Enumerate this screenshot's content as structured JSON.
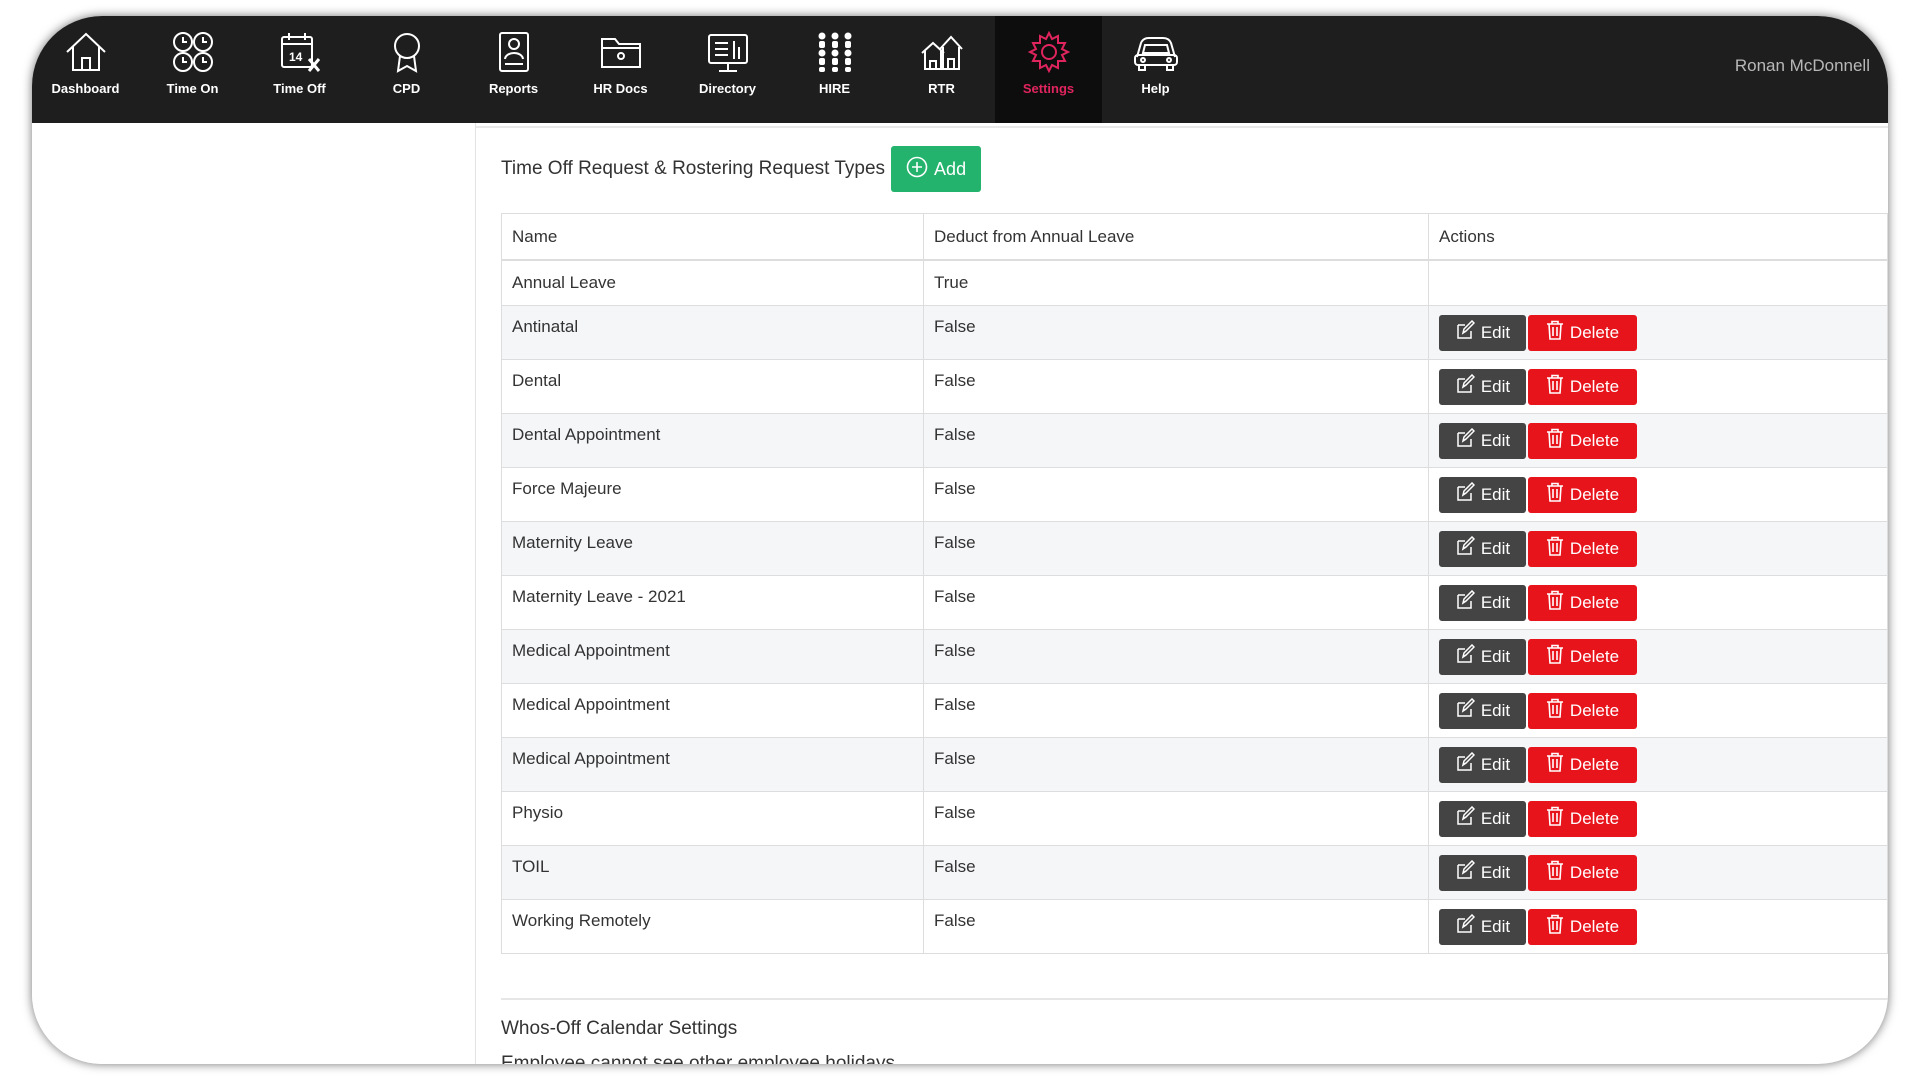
{
  "nav": {
    "items": [
      {
        "label": "Dashboard",
        "icon": "house-icon"
      },
      {
        "label": "Time On",
        "icon": "clocks-icon"
      },
      {
        "label": "Time Off",
        "icon": "calendar-x-icon"
      },
      {
        "label": "CPD",
        "icon": "award-ribbon-icon"
      },
      {
        "label": "Reports",
        "icon": "report-document-icon"
      },
      {
        "label": "HR Docs",
        "icon": "folder-icon"
      },
      {
        "label": "Directory",
        "icon": "directory-board-icon"
      },
      {
        "label": "HIRE",
        "icon": "people-grid-icon"
      },
      {
        "label": "RTR",
        "icon": "houses-icon"
      },
      {
        "label": "Settings",
        "icon": "gear-icon",
        "active": true
      },
      {
        "label": "Help",
        "icon": "car-icon"
      }
    ],
    "active_color": "#e0245e"
  },
  "user": {
    "name": "Ronan McDonnell"
  },
  "section": {
    "title": "Time Off Request & Rostering Request Types",
    "add_label": "Add"
  },
  "table": {
    "headers": [
      "Name",
      "Deduct from Annual Leave",
      "Actions"
    ],
    "edit_label": "Edit",
    "delete_label": "Delete",
    "rows": [
      {
        "name": "Annual Leave",
        "deduct": "True",
        "actions": false
      },
      {
        "name": "Antinatal",
        "deduct": "False",
        "actions": true
      },
      {
        "name": "Dental",
        "deduct": "False",
        "actions": true
      },
      {
        "name": "Dental Appointment",
        "deduct": "False",
        "actions": true
      },
      {
        "name": "Force Majeure",
        "deduct": "False",
        "actions": true
      },
      {
        "name": "Maternity Leave",
        "deduct": "False",
        "actions": true
      },
      {
        "name": "Maternity Leave - 2021",
        "deduct": "False",
        "actions": true
      },
      {
        "name": "Medical Appointment",
        "deduct": "False",
        "actions": true
      },
      {
        "name": "Medical Appointment",
        "deduct": "False",
        "actions": true
      },
      {
        "name": "Medical Appointment",
        "deduct": "False",
        "actions": true
      },
      {
        "name": "Physio",
        "deduct": "False",
        "actions": true
      },
      {
        "name": "TOIL",
        "deduct": "False",
        "actions": true
      },
      {
        "name": "Working Remotely",
        "deduct": "False",
        "actions": true
      }
    ]
  },
  "calendar": {
    "title": "Whos-Off Calendar Settings",
    "setting": "Employee cannot see other employee holidays"
  },
  "colors": {
    "topbar": "#1e1e1e",
    "add_button": "#23b36c",
    "edit_button": "#444444",
    "delete_button": "#e8141c"
  }
}
